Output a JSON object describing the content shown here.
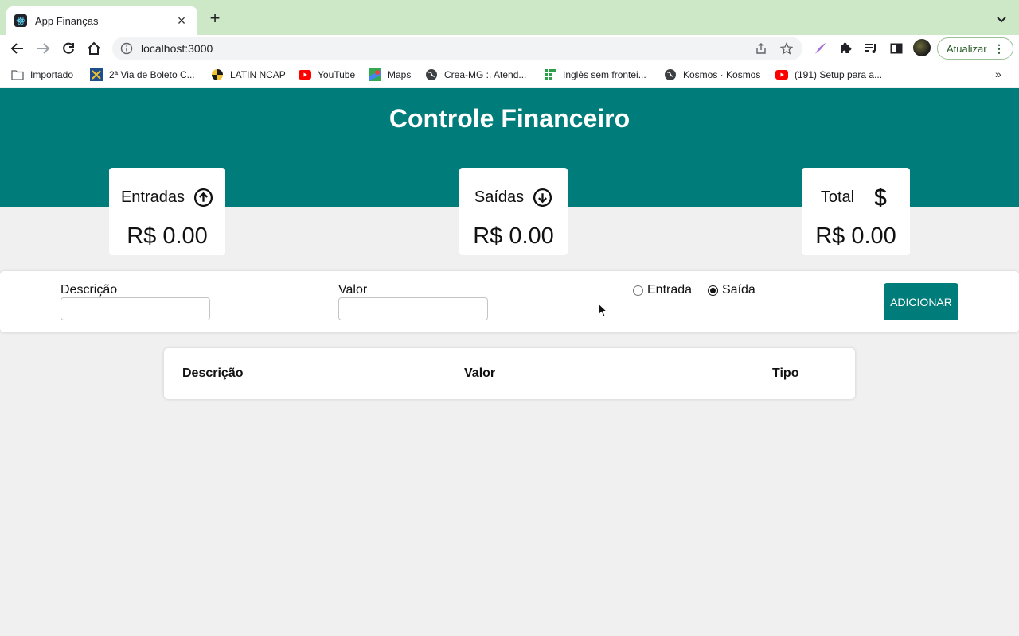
{
  "browser": {
    "tab": {
      "title": "App Finanças"
    },
    "address": {
      "url": "localhost:3000"
    },
    "update_button": {
      "label": "Atualizar"
    },
    "bookmarks": [
      {
        "label": "Importado",
        "icon": "folder-icon"
      },
      {
        "label": "2ª Via de Boleto C...",
        "icon": "boleto-icon"
      },
      {
        "label": "LATIN NCAP",
        "icon": "latin-ncap-icon"
      },
      {
        "label": "YouTube",
        "icon": "youtube-icon"
      },
      {
        "label": "Maps",
        "icon": "maps-icon"
      },
      {
        "label": "Crea-MG :. Atend...",
        "icon": "globe-icon"
      },
      {
        "label": "Inglês sem frontei...",
        "icon": "grid-icon"
      },
      {
        "label": "Kosmos · Kosmos",
        "icon": "globe-icon"
      },
      {
        "label": "(191) Setup para a...",
        "icon": "youtube-icon"
      }
    ],
    "more_bookmarks": "»"
  },
  "app": {
    "title": "Controle Financeiro",
    "cards": {
      "income": {
        "label": "Entradas",
        "value": "R$ 0.00",
        "icon": "arrow-up-circle-icon"
      },
      "expense": {
        "label": "Saídas",
        "value": "R$ 0.00",
        "icon": "arrow-down-circle-icon"
      },
      "total": {
        "label": "Total",
        "value": "R$ 0.00",
        "icon": "dollar-icon"
      }
    },
    "form": {
      "description_label": "Descrição",
      "description_value": "",
      "amount_label": "Valor",
      "amount_value": "",
      "type_options": [
        {
          "label": "Entrada",
          "checked": false
        },
        {
          "label": "Saída",
          "checked": true
        }
      ],
      "submit_label": "ADICIONAR"
    },
    "table": {
      "headers": [
        "Descrição",
        "Valor",
        "Tipo"
      ],
      "rows": []
    },
    "colors": {
      "primary": "#007d7a",
      "background": "#f0f0f0",
      "tabstrip": "#cde8c7"
    }
  }
}
